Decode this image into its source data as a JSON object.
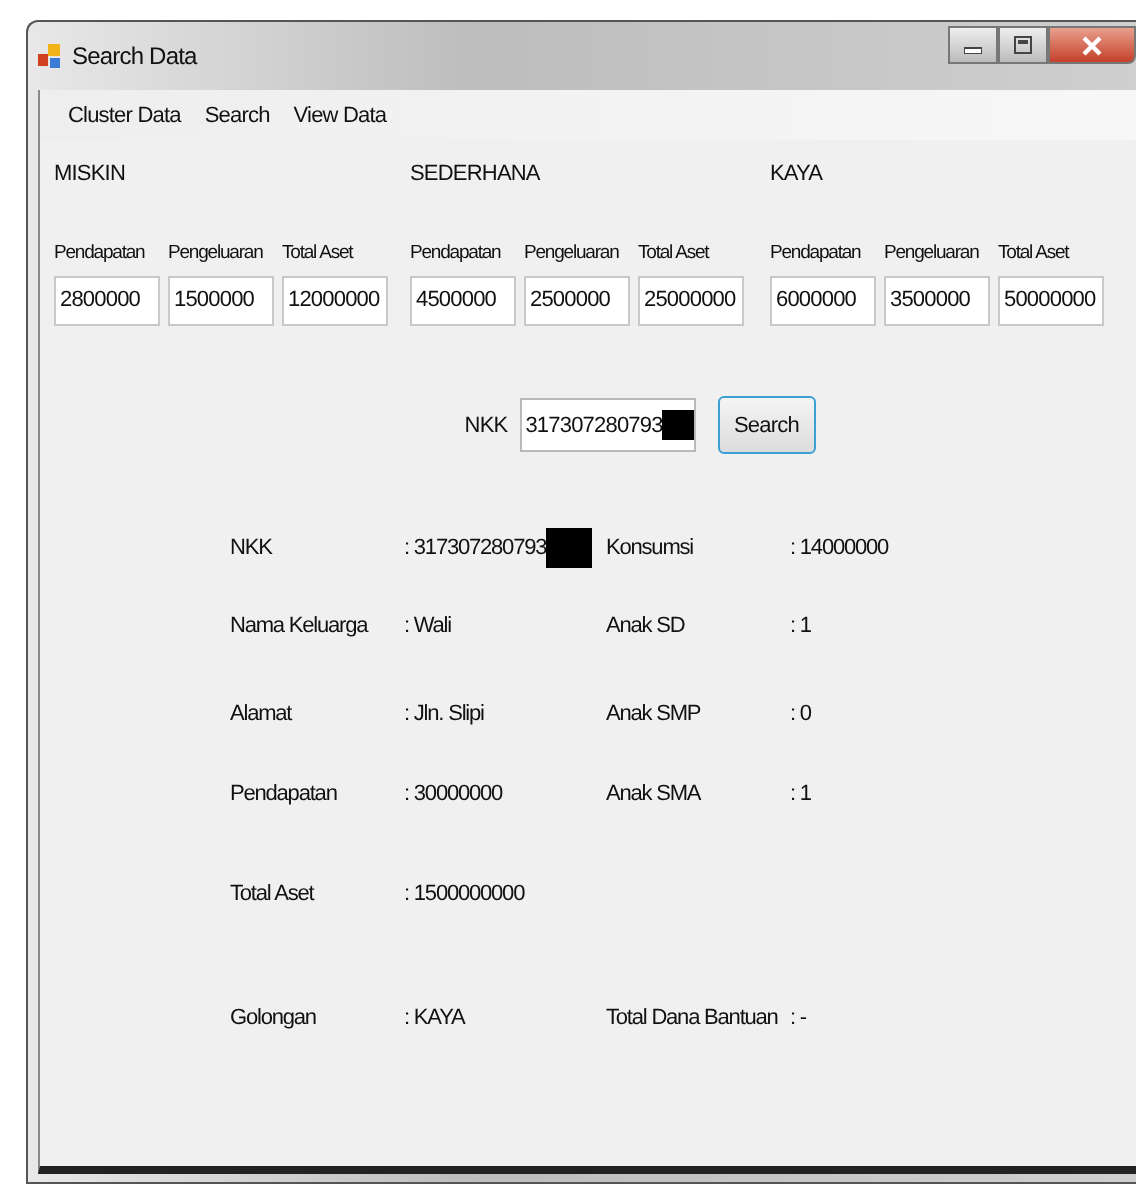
{
  "window": {
    "title": "Search Data"
  },
  "menu": [
    {
      "label": "Cluster Data"
    },
    {
      "label": "Search"
    },
    {
      "label": "View Data"
    }
  ],
  "clusters": [
    {
      "name": "MISKIN",
      "fields": [
        {
          "label": "Pendapatan",
          "value": "2800000"
        },
        {
          "label": "Pengeluaran",
          "value": "1500000"
        },
        {
          "label": "Total Aset",
          "value": "12000000"
        }
      ]
    },
    {
      "name": "SEDERHANA",
      "fields": [
        {
          "label": "Pendapatan",
          "value": "4500000"
        },
        {
          "label": "Pengeluaran",
          "value": "2500000"
        },
        {
          "label": "Total Aset",
          "value": "25000000"
        }
      ]
    },
    {
      "name": "KAYA",
      "fields": [
        {
          "label": "Pendapatan",
          "value": "6000000"
        },
        {
          "label": "Pengeluaran",
          "value": "3500000"
        },
        {
          "label": "Total Aset",
          "value": "50000000"
        }
      ]
    }
  ],
  "search": {
    "label": "NKK",
    "value": "317307280793",
    "redacted": true,
    "button": "Search"
  },
  "details": [
    {
      "left": {
        "label": "NKK",
        "value": ": 317307280793",
        "redacted": true
      },
      "right": {
        "label": "Konsumsi",
        "value": ": 14000000"
      }
    },
    {
      "left": {
        "label": "Nama Keluarga",
        "value": ": Wali"
      },
      "right": {
        "label": "Anak SD",
        "value": ": 1"
      }
    },
    {
      "left": {
        "label": "Alamat",
        "value": ": Jln. Slipi"
      },
      "right": {
        "label": "Anak SMP",
        "value": ": 0"
      }
    },
    {
      "left": {
        "label": "Pendapatan",
        "value": ": 30000000"
      },
      "right": {
        "label": "Anak SMA",
        "value": ": 1"
      }
    },
    {
      "left": {
        "label": "Total Aset",
        "value": ": 1500000000"
      }
    },
    {
      "left": {
        "label": "Golongan",
        "value": ": KAYA"
      },
      "right": {
        "label": "Total Dana Bantuan",
        "value": ": -"
      }
    }
  ]
}
